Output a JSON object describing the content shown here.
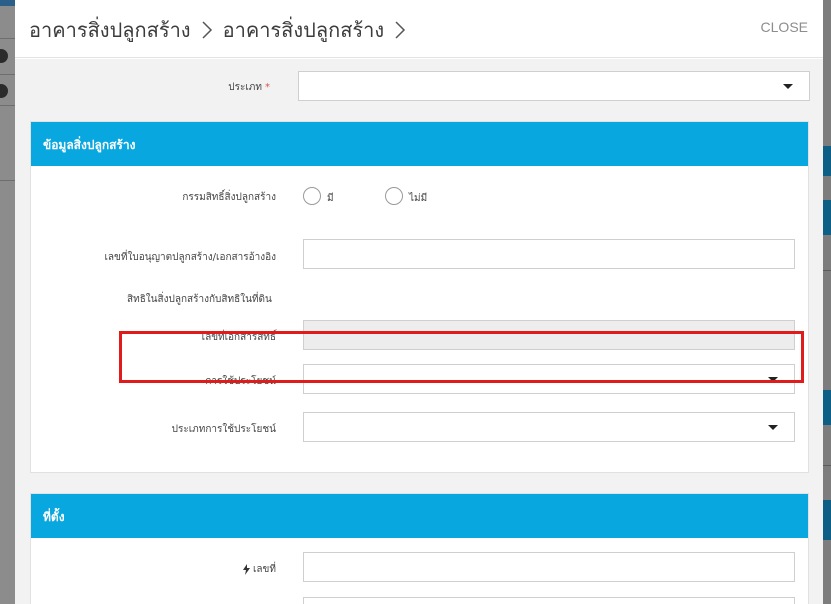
{
  "header": {
    "breadcrumb": [
      "อาคารสิ่งปลูกสร้าง",
      "อาคารสิ่งปลูกสร้าง"
    ],
    "close_label": "CLOSE"
  },
  "type_field": {
    "label": "ประเภท",
    "required_mark": "*",
    "value": ""
  },
  "building_info": {
    "title": "ข้อมูลสิ่งปลูกสร้าง",
    "ownership_label": "กรรมสิทธิ์สิ่งปลูกสร้าง",
    "ownership_options": [
      "มี",
      "ไม่มี"
    ],
    "license_label": "เลขที่ใบอนุญาตปลูกสร้าง/เอกสารอ้างอิง",
    "license_value": "",
    "rights_label": "สิทธิในสิ่งปลูกสร้างกับสิทธิในที่ดิน",
    "deed_label": "เลขที่เอกสารสิทธิ์",
    "deed_value": "",
    "usage_label": "การใช้ประโยชน์",
    "usage_value": "",
    "usage_type_label": "ประเภทการใช้ประโยชน์",
    "usage_type_value": ""
  },
  "location": {
    "title": "ที่ตั้ง",
    "number_label": "เลขที่",
    "number_value": ""
  },
  "colors": {
    "panel_header": "#09a7e0",
    "highlight": "#e01b1b",
    "required": "#d9534f"
  },
  "icons": {
    "breadcrumb_separator": "chevron-right-icon",
    "dropdown": "caret-down-icon",
    "number_prefix": "lightning-bolt-icon"
  }
}
